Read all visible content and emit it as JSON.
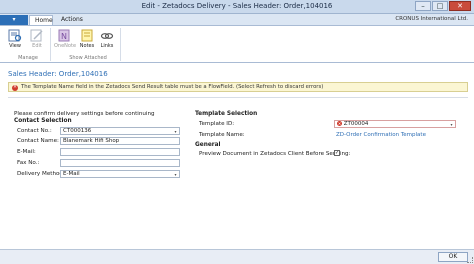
{
  "window": {
    "title": "Edit - Zetadocs Delivery - Sales Header: Order,104016",
    "company": "CRONUS International Ltd.",
    "buttons": [
      "–",
      "□",
      "✕"
    ]
  },
  "tabs": [
    {
      "label": "▾"
    },
    {
      "label": "Home"
    },
    {
      "label": "Actions"
    }
  ],
  "ribbon": {
    "buttons": [
      {
        "label": "View",
        "icon": "view-icon"
      },
      {
        "label": "Edit",
        "icon": "edit-icon"
      },
      {
        "label": "OneNote",
        "icon": "onenote-icon"
      },
      {
        "label": "Notes",
        "icon": "notes-icon"
      },
      {
        "label": "Links",
        "icon": "links-icon"
      }
    ],
    "groups": [
      "Manage",
      "Show Attached"
    ]
  },
  "page_title": "Sales Header: Order,104016",
  "error": "The Template Name field in the Zetadocs Send Result table must be a FlowField. (Select Refresh to discard errors)",
  "instructions": "Please confirm delivery settings before continuing",
  "contact_section": {
    "heading": "Contact Selection",
    "fields": [
      {
        "label": "Contact No.:",
        "value": "CT000136"
      },
      {
        "label": "Contact Name:",
        "value": "Blanemark Hifi Shop"
      },
      {
        "label": "E-Mail:",
        "value": ""
      },
      {
        "label": "Fax No.:",
        "value": ""
      },
      {
        "label": "Delivery Method:",
        "value": "E-Mail"
      }
    ]
  },
  "template_section": {
    "heading": "Template Selection",
    "template_id_label": "Template ID:",
    "template_id_value": "ZT00004",
    "template_name_label": "Template Name:",
    "template_name_value": "ZD-Order Confirmation Template"
  },
  "general_section": {
    "heading": "General",
    "preview_label": "Preview Document in Zetadocs Client Before Sending:",
    "preview_checked": true,
    "check_mark": "✓"
  },
  "ok_label": "OK",
  "colors": {
    "accent": "#2f6fb5",
    "error": "#cf3a2b",
    "error_bg": "#fbf6d3"
  }
}
